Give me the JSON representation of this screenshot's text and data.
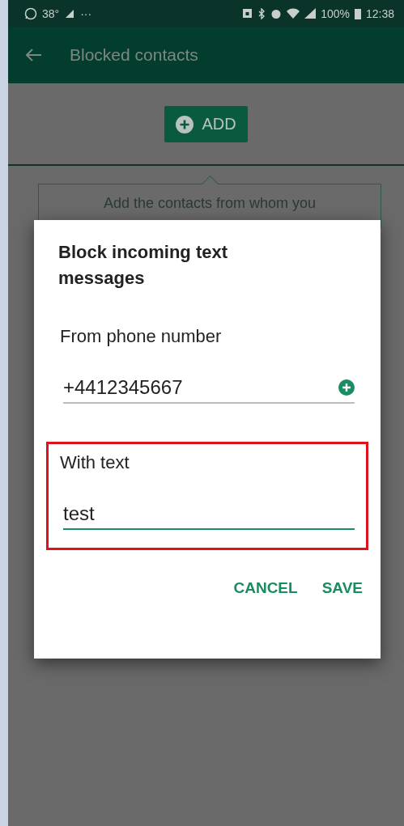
{
  "status_bar": {
    "temperature": "38°",
    "more": "···",
    "battery": "100%",
    "time": "12:38"
  },
  "app_bar": {
    "title": "Blocked contacts"
  },
  "add_button": {
    "label": "ADD"
  },
  "hint": {
    "text": "Add the contacts from whom you"
  },
  "dialog": {
    "title": "Block incoming text messages",
    "fields": [
      {
        "label": "From phone number",
        "value": "+4412345667",
        "focused": false,
        "add_icon": true,
        "highlighted": false
      },
      {
        "label": "With text",
        "value": "test",
        "focused": true,
        "add_icon": false,
        "highlighted": true
      }
    ],
    "buttons": [
      "CANCEL",
      "SAVE"
    ]
  }
}
